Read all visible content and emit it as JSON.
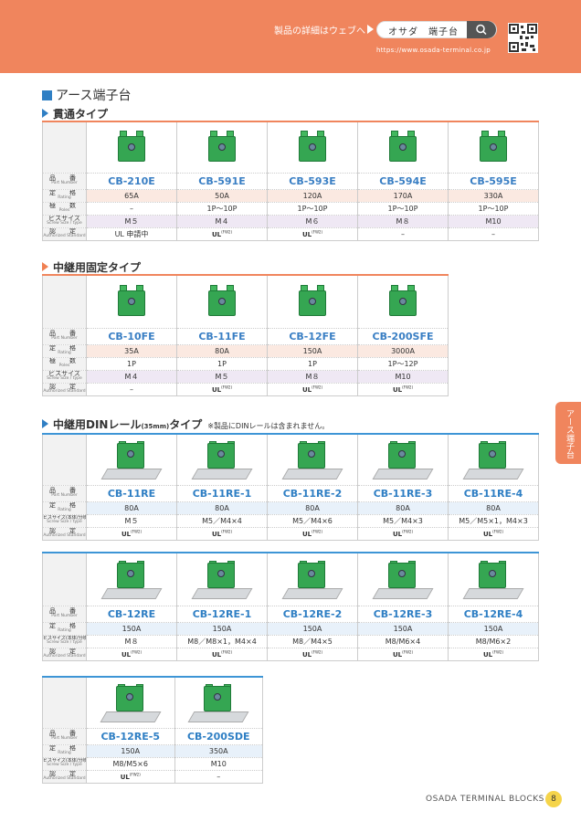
{
  "header": {
    "web_text": "製品の詳細はウェブへ",
    "search_text": "オサダ　端子台",
    "url": "https://www.osada-terminal.co.jp"
  },
  "page_title": "アース端子台",
  "labels": {
    "part_jp": "品　番",
    "part_en": "Part Number",
    "rating_jp": "定　格",
    "rating_en": "Rating",
    "poles_jp": "極　数",
    "poles_en": "Poles",
    "screw_jp": "ビスサイズ",
    "screw_en": "Screw Size / type",
    "screw2_jp": "ビスサイズ(本体/分岐側)",
    "screw2_en": "Screw Size / type",
    "std_jp": "認　定",
    "std_en": "Authorized Standard"
  },
  "ul_mark": "c",
  "ul_suffix": "(FW2)",
  "sections": {
    "through": {
      "title": "貫通タイプ",
      "products": [
        {
          "name": "CB-210E",
          "rating": "65A",
          "poles": "–",
          "screw": "M５",
          "std": "UL 申請中"
        },
        {
          "name": "CB-591E",
          "rating": "50A",
          "poles": "1P～10P",
          "screw": "M４",
          "std": "UL"
        },
        {
          "name": "CB-593E",
          "rating": "120A",
          "poles": "1P～10P",
          "screw": "M６",
          "std": "UL"
        },
        {
          "name": "CB-594E",
          "rating": "170A",
          "poles": "1P～10P",
          "screw": "M８",
          "std": "–"
        },
        {
          "name": "CB-595E",
          "rating": "330A",
          "poles": "1P～10P",
          "screw": "M10",
          "std": "–"
        }
      ]
    },
    "relay": {
      "title": "中継用固定タイプ",
      "products": [
        {
          "name": "CB-10FE",
          "rating": "35A",
          "poles": "1P",
          "screw": "M４",
          "std": "–"
        },
        {
          "name": "CB-11FE",
          "rating": "80A",
          "poles": "1P",
          "screw": "M５",
          "std": "UL"
        },
        {
          "name": "CB-12FE",
          "rating": "150A",
          "poles": "1P",
          "screw": "M８",
          "std": "UL"
        },
        {
          "name": "CB-200SFE",
          "rating": "3000A",
          "poles": "1P～12P",
          "screw": "M10",
          "std": "UL"
        }
      ]
    },
    "din": {
      "title": "中継用DINレール",
      "title_small": "(35mm)",
      "title_suffix": "タイプ",
      "note": "※製品にDINレールは含まれません。",
      "table1": [
        {
          "name": "CB-11RE",
          "rating": "80A",
          "screw": "M５",
          "std": "UL"
        },
        {
          "name": "CB-11RE-1",
          "rating": "80A",
          "screw": "M5／M4×4",
          "std": "UL"
        },
        {
          "name": "CB-11RE-2",
          "rating": "80A",
          "screw": "M5／M4×6",
          "std": "UL"
        },
        {
          "name": "CB-11RE-3",
          "rating": "80A",
          "screw": "M5／M4×3",
          "std": "UL"
        },
        {
          "name": "CB-11RE-4",
          "rating": "80A",
          "screw": "M5／M5×1，M4×3",
          "std": "UL"
        }
      ],
      "table2": [
        {
          "name": "CB-12RE",
          "rating": "150A",
          "screw": "M８",
          "std": "UL"
        },
        {
          "name": "CB-12RE-1",
          "rating": "150A",
          "screw": "M8／M8×1，M4×4",
          "std": "UL"
        },
        {
          "name": "CB-12RE-2",
          "rating": "150A",
          "screw": "M8／M4×5",
          "std": "UL"
        },
        {
          "name": "CB-12RE-3",
          "rating": "150A",
          "screw": "M8/M6×4",
          "std": "UL"
        },
        {
          "name": "CB-12RE-4",
          "rating": "150A",
          "screw": "M8/M6×2",
          "std": "UL"
        }
      ],
      "table3": [
        {
          "name": "CB-12RE-5",
          "rating": "150A",
          "screw": "M8/M5×6",
          "std": "UL"
        },
        {
          "name": "CB-200SDE",
          "rating": "350A",
          "screw": "M10",
          "std": "–"
        }
      ]
    }
  },
  "side_tab": "アース端子台",
  "footer": {
    "text": "OSADA TERMINAL BLOCKS",
    "page": "8"
  }
}
